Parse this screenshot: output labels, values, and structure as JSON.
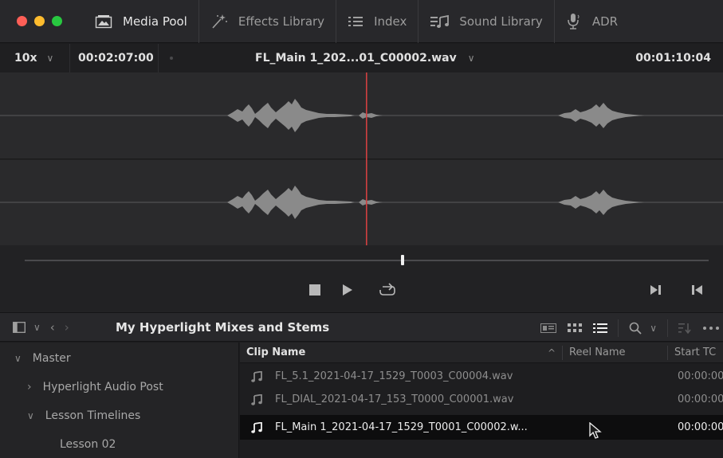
{
  "toolbar": {
    "tabs": [
      {
        "label": "Media Pool",
        "icon": "media-pool-icon",
        "active": true
      },
      {
        "label": "Effects Library",
        "icon": "magic-wand-icon",
        "active": false
      },
      {
        "label": "Index",
        "icon": "list-icon",
        "active": false
      },
      {
        "label": "Sound Library",
        "icon": "sound-library-icon",
        "active": false
      },
      {
        "label": "ADR",
        "icon": "microphone-icon",
        "active": false
      }
    ]
  },
  "viewer": {
    "zoom": "10x",
    "timecode_left": "00:02:07:00",
    "clip_title": "FL_Main 1_202...01_C00002.wav",
    "timecode_right": "00:01:10:04",
    "playhead_color": "#d04040"
  },
  "transport": {
    "controls": [
      "stop-icon",
      "play-icon",
      "loop-icon",
      "next-clip-icon",
      "previous-clip-icon"
    ]
  },
  "media_pool": {
    "title": "My Hyperlight Mixes and Stems",
    "bins": [
      {
        "label": "Master",
        "expanded": true
      },
      {
        "label": "Hyperlight Audio Post",
        "expanded": false
      },
      {
        "label": "Lesson Timelines",
        "expanded": true
      },
      {
        "label": "Lesson 02"
      }
    ],
    "columns": {
      "name": "Clip Name",
      "reel": "Reel Name",
      "start": "Start TC"
    },
    "clips": [
      {
        "name": "FL_5.1_2021-04-17_1529_T0003_C00004.wav",
        "start": "00:00:00",
        "selected": false
      },
      {
        "name": "FL_DIAL_2021-04-17_153_T0000_C00001.wav",
        "start": "00:00:00",
        "selected": false
      },
      {
        "name": "FL_Main 1_2021-04-17_1529_T0001_C00002.w...",
        "start": "00:00:00",
        "selected": true
      }
    ]
  }
}
